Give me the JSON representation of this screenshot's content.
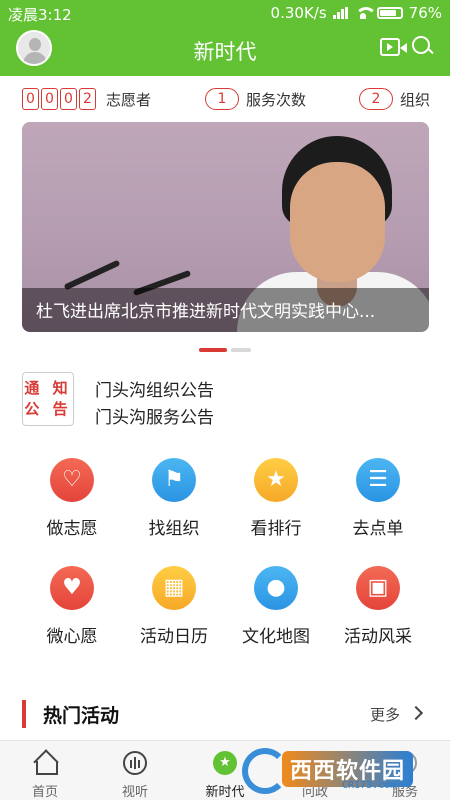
{
  "status_bar": {
    "time": "凌晨3:12",
    "network_speed": "0.30K/s",
    "battery": "76%"
  },
  "header": {
    "title": "新时代",
    "icons": [
      "avatar",
      "video-icon",
      "search-icon"
    ]
  },
  "stats": {
    "volunteer_digits": [
      "0",
      "0",
      "0",
      "2"
    ],
    "volunteer_label": "志愿者",
    "service_count": "1",
    "service_label": "服务次数",
    "org_count": "2",
    "org_label": "组织"
  },
  "banner": {
    "caption": "杜飞进出席北京市推进新时代文明实践中心...",
    "active_slide": 1,
    "slide_count": 2
  },
  "notice": {
    "badge_line1": "通 知",
    "badge_line2": "公 告",
    "items": [
      "门头沟组织公告",
      "门头沟服务公告"
    ]
  },
  "grid": {
    "items": [
      {
        "label": "做志愿",
        "icon": "heart-icon",
        "color": "#e4443a"
      },
      {
        "label": "找组织",
        "icon": "flag-icon",
        "color": "#2a94e3"
      },
      {
        "label": "看排行",
        "icon": "medal-icon",
        "color": "#f6a927"
      },
      {
        "label": "去点单",
        "icon": "clipboard-icon",
        "color": "#2a94e3"
      },
      {
        "label": "微心愿",
        "icon": "wish-card-icon",
        "color": "#e4443a"
      },
      {
        "label": "活动日历",
        "icon": "calendar-icon",
        "color": "#f6a927"
      },
      {
        "label": "文化地图",
        "icon": "map-pin-icon",
        "color": "#2a94e3"
      },
      {
        "label": "活动风采",
        "icon": "photo-icon",
        "color": "#e4443a"
      }
    ]
  },
  "hot": {
    "title": "热门活动",
    "more": "更多"
  },
  "nav": {
    "items": [
      {
        "label": "首页",
        "icon": "home-icon"
      },
      {
        "label": "视听",
        "icon": "audio-icon"
      },
      {
        "label": "新时代",
        "icon": "star-icon",
        "active": true
      },
      {
        "label": "问政",
        "icon": "ask-icon"
      },
      {
        "label": "服务",
        "icon": "service-icon"
      }
    ]
  },
  "watermark": {
    "text": "西西软件园",
    "sub": "CR173.com"
  },
  "colors": {
    "brand_green": "#63c234",
    "accent_red": "#d83a35"
  }
}
